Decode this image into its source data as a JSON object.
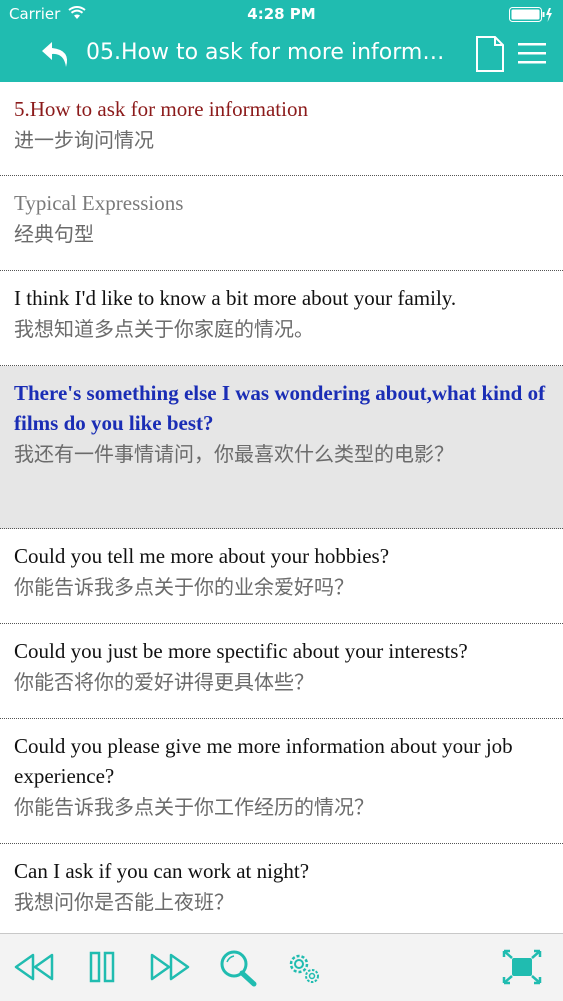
{
  "status_bar": {
    "carrier": "Carrier",
    "time": "4:28 PM"
  },
  "nav": {
    "title": "05.How to ask for more information"
  },
  "rows": [
    {
      "en": "5.How to ask for more information",
      "zh": "进一步询问情况"
    },
    {
      "en": "Typical Expressions",
      "zh": "经典句型"
    },
    {
      "en": "I think I'd like to know a bit more about your family.",
      "zh": "我想知道多点关于你家庭的情况。"
    },
    {
      "en": "There's something else I was wondering about,what kind of films do you like best?",
      "zh": "我还有一件事情请问，你最喜欢什么类型的电影？"
    },
    {
      "en": "Could you tell me more about your hobbies?",
      "zh": "你能告诉我多点关于你的业余爱好吗？"
    },
    {
      "en": "Could you just be more spectific about your interests?",
      "zh": "你能否将你的爱好讲得更具体些？"
    },
    {
      "en": "Could you please give me more information about your job experience?",
      "zh": "你能告诉我多点关于你工作经历的情况？"
    },
    {
      "en": "Can I ask if you can work at night?",
      "zh": "我想问你是否能上夜班？"
    }
  ],
  "icons": {
    "back": "undo-arrow-icon",
    "doc": "document-icon",
    "menu": "menu-icon",
    "rewind": "rewind-icon",
    "pause": "pause-icon",
    "forward": "fast-forward-icon",
    "search": "search-icon",
    "settings": "gear-icon",
    "fullscreen": "fullscreen-icon"
  },
  "colors": {
    "header": "#20bcb0",
    "heading_text": "#8b1a1a",
    "active_text": "#1a2db5",
    "icon_teal": "#20bcb0"
  }
}
